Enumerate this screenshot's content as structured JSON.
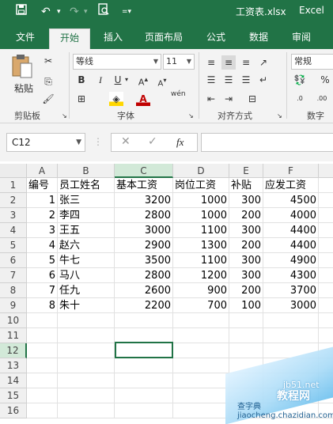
{
  "title": "工资表.xlsx",
  "app_name": "Excel",
  "tabs": [
    "文件",
    "开始",
    "插入",
    "页面布局",
    "公式",
    "数据",
    "审阅"
  ],
  "ribbon": {
    "paste_label": "粘贴",
    "clipboard_label": "剪贴板",
    "font_name": "等线",
    "font_size": "11",
    "font_group_label": "字体",
    "wen_label": "wén",
    "align_group_label": "对齐方式",
    "number_format": "常规",
    "number_group_label": "数字",
    "accent": "#217346"
  },
  "formula_bar": {
    "name_box": "C12",
    "fx": "fx",
    "content": ""
  },
  "columns": [
    "A",
    "B",
    "C",
    "D",
    "E",
    "F"
  ],
  "rows": [
    [
      "编号",
      "员工姓名",
      "基本工资",
      "岗位工资",
      "补贴",
      "应发工资"
    ],
    [
      "1",
      "张三",
      "3200",
      "1000",
      "300",
      "4500"
    ],
    [
      "2",
      "李四",
      "2800",
      "1000",
      "200",
      "4000"
    ],
    [
      "3",
      "王五",
      "3000",
      "1100",
      "300",
      "4400"
    ],
    [
      "4",
      "赵六",
      "2900",
      "1300",
      "200",
      "4400"
    ],
    [
      "5",
      "牛七",
      "3500",
      "1100",
      "300",
      "4900"
    ],
    [
      "6",
      "马八",
      "2800",
      "1200",
      "300",
      "4300"
    ],
    [
      "7",
      "任九",
      "2600",
      "900",
      "200",
      "3700"
    ],
    [
      "8",
      "朱十",
      "2200",
      "700",
      "100",
      "3000"
    ]
  ],
  "row_numbers": [
    "1",
    "2",
    "3",
    "4",
    "5",
    "6",
    "7",
    "8",
    "9",
    "10",
    "11",
    "12",
    "13",
    "14",
    "15",
    "16"
  ],
  "watermark": {
    "site": "jb51.net",
    "name": "教程网",
    "sub": "查字典 jiaocheng.chazidian.com"
  }
}
